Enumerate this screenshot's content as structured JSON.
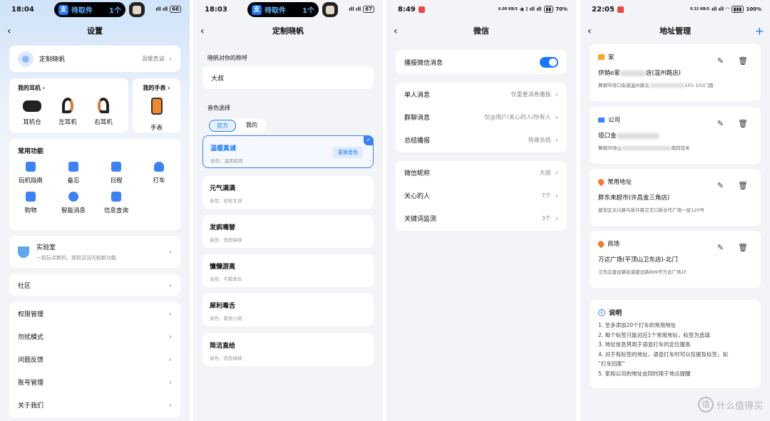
{
  "screen1": {
    "time": "18:04",
    "pill_label": "待取件",
    "pill_count": "1个",
    "battery": "66",
    "title": "设置",
    "profile": {
      "name": "定制晓帆",
      "value": "温暖真诚"
    },
    "earphones": {
      "title": "我的耳机",
      "items": [
        "耳机仓",
        "左耳机",
        "右耳机"
      ]
    },
    "watch": {
      "title": "我的手表",
      "item": "手表"
    },
    "functions": {
      "title": "常用功能",
      "items": [
        "玩机指南",
        "备忘",
        "日程",
        "打车",
        "购物",
        "智能消息",
        "信息查询"
      ]
    },
    "lab": {
      "title": "实验室",
      "sub": "一起玩点新的，提前试试光帆新功能"
    },
    "community": "社区",
    "menu": [
      "权限管理",
      "勿扰模式",
      "问题反馈",
      "账号管理",
      "关于我们"
    ]
  },
  "screen2": {
    "time": "18:03",
    "pill_label": "待取件",
    "pill_count": "1个",
    "battery": "67",
    "title": "定制晓帆",
    "nickname_label": "晓帆对你的称呼",
    "nickname": "大叔",
    "voice_label": "音色选择",
    "tabs": [
      "官方",
      "我的"
    ],
    "change_btn": "更换音色",
    "voices": [
      {
        "name": "温暖真诚",
        "desc": "音色：温柔姐姐"
      },
      {
        "name": "元气满满",
        "desc": "音色：软软女孩"
      },
      {
        "name": "发疯嘴替",
        "desc": "音色：俏皮搞妹"
      },
      {
        "name": "慵懒游离",
        "desc": "音色：不羁青年"
      },
      {
        "name": "犀利毒舌",
        "desc": "音色：嚣张小姐"
      },
      {
        "name": "简洁直给",
        "desc": "音色：俏皮搞妹"
      }
    ]
  },
  "screen3": {
    "time": "8:49",
    "battery": "70%",
    "net": "6.00 KB/S",
    "title": "微信",
    "broadcast": "播报微信消息",
    "settings": [
      {
        "label": "单人消息",
        "value": "仅重要消息播报"
      },
      {
        "label": "群聊消息",
        "value": "仅@用户/关心的人/所有人"
      },
      {
        "label": "总结播报",
        "value": "快速总结"
      }
    ],
    "more": [
      {
        "label": "微信昵称",
        "value": "大叔"
      },
      {
        "label": "关心的人",
        "value": "7个"
      },
      {
        "label": "关键词监测",
        "value": "3个"
      }
    ]
  },
  "screen4": {
    "time": "22:05",
    "battery": "100%",
    "net": "0.32 KB/S",
    "title": "地址管理",
    "addresses": [
      {
        "tag": "家",
        "name": "供销e家",
        "name_tail": "店(温州路店)",
        "detail": "舞钢市垭口街道温州路北",
        "detail_tail": "101-102门面",
        "color": "#f5a623"
      },
      {
        "tag": "公司",
        "name": "垭口金",
        "name_tail": "",
        "detail": "舞钢市垭山",
        "detail_tail": "南四百米",
        "color": "#3b82f6"
      },
      {
        "tag": "常用地址",
        "name": "胖东来超市(许昌金三角店)",
        "name_tail": "",
        "detail": "建安区文兴路与新许路交叉口新合作广场一层120号",
        "detail_tail": "",
        "color": "#f07b2d"
      },
      {
        "tag": "商场",
        "name": "万达广场(平顶山卫东店)-北门",
        "name_tail": "",
        "detail": "卫东区建设路街道建设路899号万达广场1F",
        "detail_tail": "",
        "color": "#f07b2d"
      }
    ],
    "notes_title": "说明",
    "notes": [
      "1. 至多添加20个打车的常用地址",
      "2. 每个标签只能对应1个常用地址，标签为选填",
      "3. 地址信息将用于语音打车的定位服务",
      "4. 对于有标签的地址，语音打车时可以仅提及标签，如",
      "“打车回家”",
      "5. 家和公司的地址会同时用于地点提醒"
    ],
    "watermark": "什么值得买"
  }
}
